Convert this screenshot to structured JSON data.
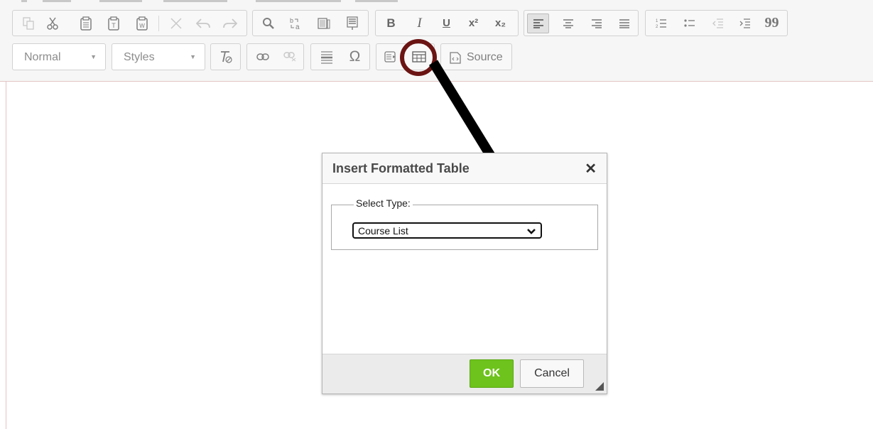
{
  "toolbar": {
    "format_combo": {
      "label": "Normal"
    },
    "styles_combo": {
      "label": "Styles"
    },
    "source_button": {
      "label": "Source"
    },
    "icons": {
      "copy": "copy-icon",
      "cut": "cut-icon",
      "paste": "paste-icon",
      "paste_text": "paste-text-icon",
      "paste_word": "paste-word-icon",
      "remove": "remove-icon",
      "undo": "undo-icon",
      "redo": "redo-icon",
      "find": "find-icon",
      "replace": "replace-icon",
      "select_all": "select-all-icon",
      "spellcheck": "spellcheck-icon",
      "bold": "B",
      "italic": "I",
      "underline": "U",
      "superscript": "superscript-icon",
      "subscript": "subscript-icon",
      "align_left": "align-left-icon",
      "align_center": "align-center-icon",
      "align_right": "align-right-icon",
      "justify": "justify-icon",
      "numbered_list": "numbered-list-icon",
      "bulleted_list": "bulleted-list-icon",
      "outdent": "outdent-icon",
      "indent": "indent-icon",
      "blockquote": "blockquote-icon",
      "remove_format": "remove-format-icon",
      "link": "link-icon",
      "unlink": "unlink-icon",
      "horizontal_rule": "horizontal-rule-icon",
      "special_char": "omega-icon",
      "insert_template": "insert-template-icon",
      "insert_table": "table-icon"
    },
    "superscript_glyph": "x²",
    "subscript_glyph": "x₂",
    "quote_glyph": "99",
    "omega_glyph": "Ω"
  },
  "dialog": {
    "title": "Insert Formatted Table",
    "close_glyph": "✕",
    "fieldset_legend": "Select Type:",
    "select_value": "Course List",
    "ok_label": "OK",
    "cancel_label": "Cancel"
  },
  "colors": {
    "callout": "#6b1414",
    "ok_button": "#6ec31c",
    "arrow": "#000000"
  }
}
